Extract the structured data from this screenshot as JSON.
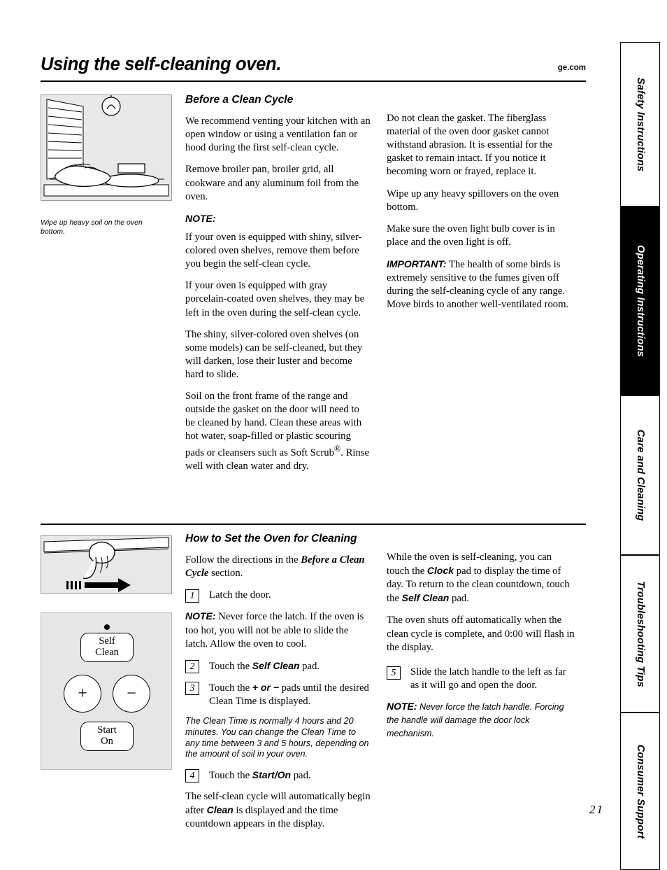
{
  "header": {
    "title": "Using the self-cleaning oven.",
    "url": "ge.com"
  },
  "side_tabs": [
    {
      "label": "Safety Instructions",
      "active": false
    },
    {
      "label": "Operating Instructions",
      "active": true
    },
    {
      "label": "Care and Cleaning",
      "active": false
    },
    {
      "label": "Troubleshooting Tips",
      "active": false
    },
    {
      "label": "Consumer Support",
      "active": false
    }
  ],
  "figure1": {
    "caption": "Wipe up heavy soil on the oven bottom.",
    "alt": "hand wiping oven bottom"
  },
  "section1": {
    "heading": "Before a Clean Cycle",
    "left": {
      "p1": "We recommend venting your kitchen with an open window or using a ventilation fan or hood during the first self-clean cycle.",
      "p2": "Remove broiler pan, broiler grid, all cookware and any aluminum foil from the oven.",
      "note_label": "NOTE:",
      "note1": "If your oven is equipped with shiny, silver-colored oven shelves, remove them before you begin the self-clean cycle.",
      "note2": "If your oven is equipped with gray porcelain-coated oven shelves, they may be left in the oven during the self-clean cycle.",
      "p3": "The shiny, silver-colored oven shelves (on some models) can be self-cleaned, but they will darken, lose their luster and become hard to slide.",
      "p4_a": "Soil on the front frame of the range and outside the gasket on the door will need to be cleaned by hand. Clean these areas with hot water, soap-filled or plastic scouring pads or cleansers such as Soft Scrub",
      "p4_sup": "®",
      "p4_b": ". Rinse well with clean water and dry."
    },
    "right": {
      "p1": "Do not clean the gasket. The fiberglass material of the oven door gasket cannot withstand abrasion. It is essential for the gasket to remain intact. If you notice it becoming worn or frayed, replace it.",
      "p2": "Wipe up any heavy spillovers on the oven bottom.",
      "p3": "Make sure the oven light bulb cover is in place and the oven light is off.",
      "important_label": "IMPORTANT:",
      "p4": " The health of some birds is extremely sensitive to the fumes given off during the self-cleaning cycle of any range. Move birds to another well-ventilated room."
    }
  },
  "section2": {
    "heading": "How to Set the Oven for Cleaning",
    "left": {
      "intro_a": "Follow the directions in the ",
      "intro_em": "Before a Clean Cycle",
      "intro_b": " section.",
      "step1_num": "1",
      "step1": "Latch the door.",
      "note_label": "NOTE:",
      "note_text": " Never force the latch. If the oven is too hot, you will not be able to slide the latch. Allow the oven to cool.",
      "step2_num": "2",
      "step2_a": "Touch the ",
      "step2_em": "Self Clean",
      "step2_b": " pad.",
      "step3_num": "3",
      "step3_a": "Touch the ",
      "step3_em": "+ or −",
      "step3_b": " pads until the desired Clean Time is displayed.",
      "clean_time_note": "The Clean Time is normally 4 hours and 20 minutes. You can change the Clean Time to any time between 3 and 5 hours, depending on the amount of soil in your oven.",
      "step4_num": "4",
      "step4_a": "Touch the ",
      "step4_em": "Start/On",
      "step4_b": " pad.",
      "closing_a": "The self-clean cycle will automatically begin after ",
      "closing_em": "Clean",
      "closing_b": " is displayed and the time countdown appears in the display."
    },
    "right": {
      "p1_a": "While the oven is self-cleaning, you can touch the ",
      "p1_em1": "Clock",
      "p1_b": " pad to display the time of day. To return to the clean countdown, touch the ",
      "p1_em2": "Self Clean",
      "p1_c": " pad.",
      "p2": "The oven shuts off automatically when the clean cycle is complete, and 0:00 will flash in the display.",
      "step5_num": "5",
      "step5": "Slide the latch handle to the left as far as it will go and open the door.",
      "note_label": "NOTE:",
      "note_text": " Never force the latch handle. Forcing the handle will damage the door lock mechanism."
    }
  },
  "control_panel": {
    "self": "Self",
    "clean": "Clean",
    "plus": "+",
    "minus": "−",
    "start": "Start",
    "on": "On"
  },
  "page_number": "21",
  "colors": {
    "tab_active_bg": "#000000",
    "image_bg": "#e8e8e8",
    "panel_bg": "#e6e6e6"
  }
}
